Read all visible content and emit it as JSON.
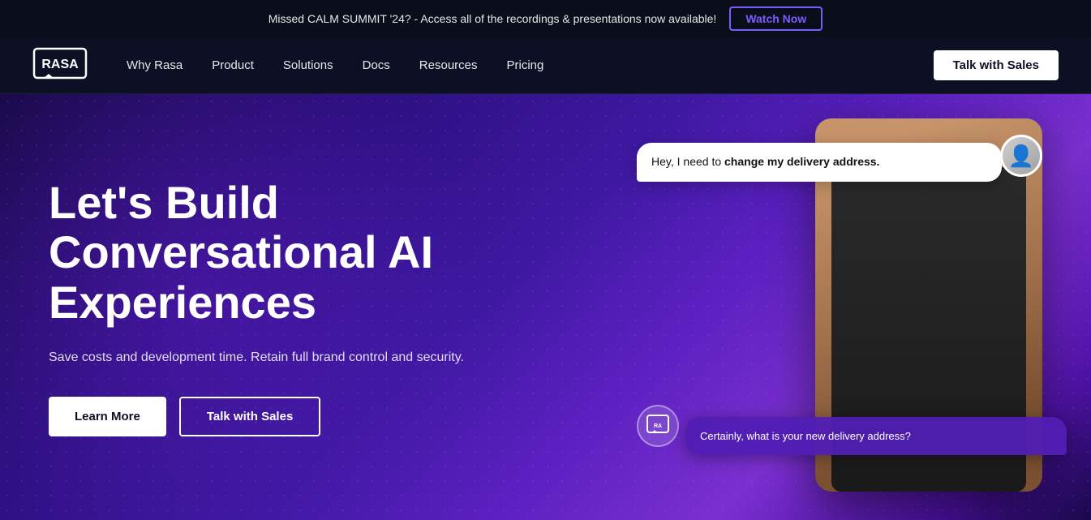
{
  "banner": {
    "text": "Missed CALM SUMMIT '24? - Access all of the recordings & presentations now available!",
    "cta_label": "Watch Now"
  },
  "nav": {
    "logo_alt": "Rasa",
    "links": [
      {
        "label": "Why Rasa",
        "href": "#"
      },
      {
        "label": "Product",
        "href": "#"
      },
      {
        "label": "Solutions",
        "href": "#"
      },
      {
        "label": "Docs",
        "href": "#"
      },
      {
        "label": "Resources",
        "href": "#"
      },
      {
        "label": "Pricing",
        "href": "#"
      }
    ],
    "cta_label": "Talk with Sales"
  },
  "hero": {
    "title": "Let's Build Conversational AI Experiences",
    "subtitle": "Save costs and development time. Retain full brand control and security.",
    "btn_learn_more": "Learn More",
    "btn_talk_sales": "Talk with Sales",
    "chat": {
      "user_message_prefix": "Hey, I need to ",
      "user_message_bold": "change my delivery address.",
      "bot_message": "Certainly, what is your new delivery address?"
    }
  }
}
